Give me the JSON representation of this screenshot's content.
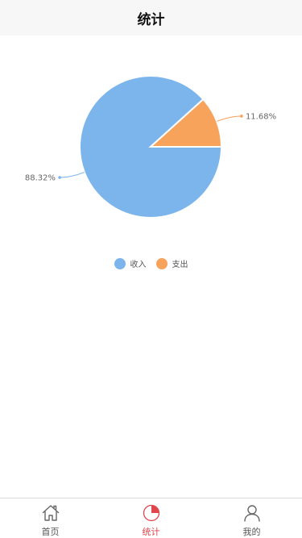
{
  "header": {
    "title": "统计"
  },
  "chart_data": {
    "type": "pie",
    "title": "",
    "categories": [
      "收入",
      "支出"
    ],
    "values": [
      88.32,
      11.68
    ],
    "labels": [
      "88.32%",
      "11.68%"
    ],
    "colors": [
      "#7cb5ec",
      "#f7a35c"
    ],
    "legend_position": "bottom-center"
  },
  "tabs": [
    {
      "label": "首页",
      "icon": "home-icon",
      "active": false
    },
    {
      "label": "统计",
      "icon": "pie-chart-icon",
      "active": true
    },
    {
      "label": "我的",
      "icon": "user-icon",
      "active": false
    }
  ],
  "accent_color": "#e0464d"
}
